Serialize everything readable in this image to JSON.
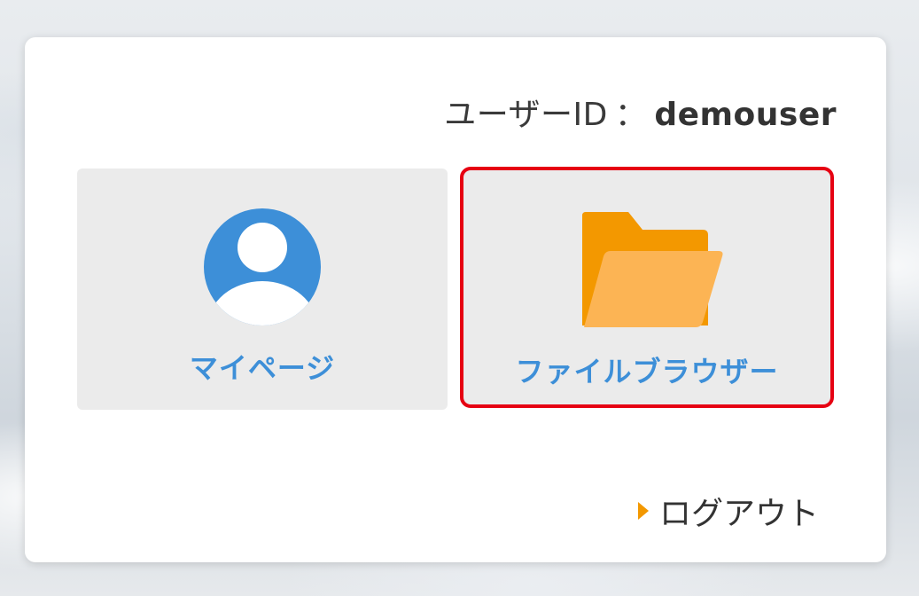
{
  "header": {
    "user_id_label": "ユーザーID",
    "separator": "：",
    "user_id_value": "demouser"
  },
  "tiles": [
    {
      "label": "マイページ",
      "icon": "user-avatar-icon"
    },
    {
      "label": "ファイルブラウザー",
      "icon": "folder-open-icon"
    }
  ],
  "footer": {
    "logout_label": "ログアウト",
    "logout_icon": "caret-right-icon"
  },
  "colors": {
    "accent_blue": "#3d8fd8",
    "folder_back": "#f39800",
    "folder_front": "#fcb454",
    "highlight_border": "#e60012",
    "arrow": "#f39800"
  }
}
